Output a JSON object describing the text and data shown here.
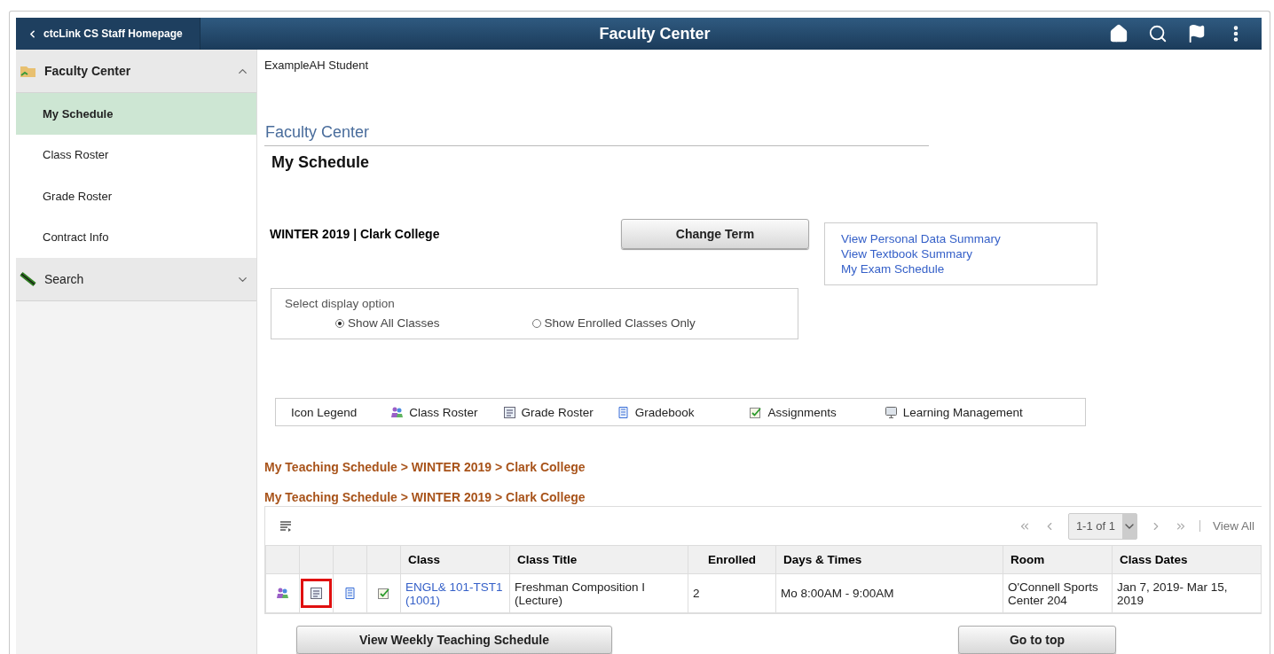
{
  "header": {
    "back_button": "ctcLink CS Staff Homepage",
    "title": "Faculty Center"
  },
  "sidebar": {
    "groups": [
      {
        "label": "Faculty Center",
        "kind": "faculty",
        "expanded": true,
        "items": [
          {
            "label": "My Schedule",
            "selected": true
          },
          {
            "label": "Class Roster",
            "selected": false
          },
          {
            "label": "Grade Roster",
            "selected": false
          },
          {
            "label": "Contract Info",
            "selected": false
          }
        ]
      },
      {
        "label": "Search",
        "kind": "search",
        "expanded": false
      }
    ]
  },
  "user_name": "ExampleAH Student",
  "page_title": "Faculty Center",
  "subtitle": "My Schedule",
  "term": "WINTER 2019 | Clark College",
  "change_term_button": "Change Term",
  "links": [
    "View Personal Data Summary",
    "View Textbook Summary",
    "My Exam Schedule"
  ],
  "display_option": {
    "label": "Select display option",
    "options": [
      {
        "label": "Show All Classes",
        "selected": true
      },
      {
        "label": "Show Enrolled Classes Only",
        "selected": false
      }
    ]
  },
  "icon_legend": {
    "title": "Icon Legend",
    "items": [
      {
        "kind": "class-roster",
        "label": "Class Roster"
      },
      {
        "kind": "grade-roster",
        "label": "Grade Roster"
      },
      {
        "kind": "gradebook",
        "label": "Gradebook"
      },
      {
        "kind": "assignments",
        "label": "Assignments"
      },
      {
        "kind": "learning",
        "label": "Learning Management"
      }
    ]
  },
  "breadcrumbs": [
    "My Teaching Schedule > WINTER 2019 > Clark College",
    "My Teaching Schedule > WINTER 2019 > Clark College"
  ],
  "grid": {
    "pager": "1-1 of 1",
    "view_all": "View All",
    "columns": [
      "Class",
      "Class Title",
      "Enrolled",
      "Days & Times",
      "Room",
      "Class Dates"
    ],
    "rows": [
      {
        "actions": [
          {
            "kind": "class-roster",
            "highlighted": false
          },
          {
            "kind": "grade-roster",
            "highlighted": true
          },
          {
            "kind": "gradebook",
            "highlighted": false
          },
          {
            "kind": "assignments",
            "highlighted": false
          }
        ],
        "class": "ENGL& 101-TST1 (1001)",
        "title": "Freshman Composition I (Lecture)",
        "enrolled": "2",
        "days_times": "Mo 8:00AM - 9:00AM",
        "room": "O'Connell Sports Center 204",
        "dates": "Jan 7, 2019- Mar 15, 2019"
      }
    ]
  },
  "buttons": [
    "View Weekly Teaching Schedule",
    "Go to top"
  ]
}
